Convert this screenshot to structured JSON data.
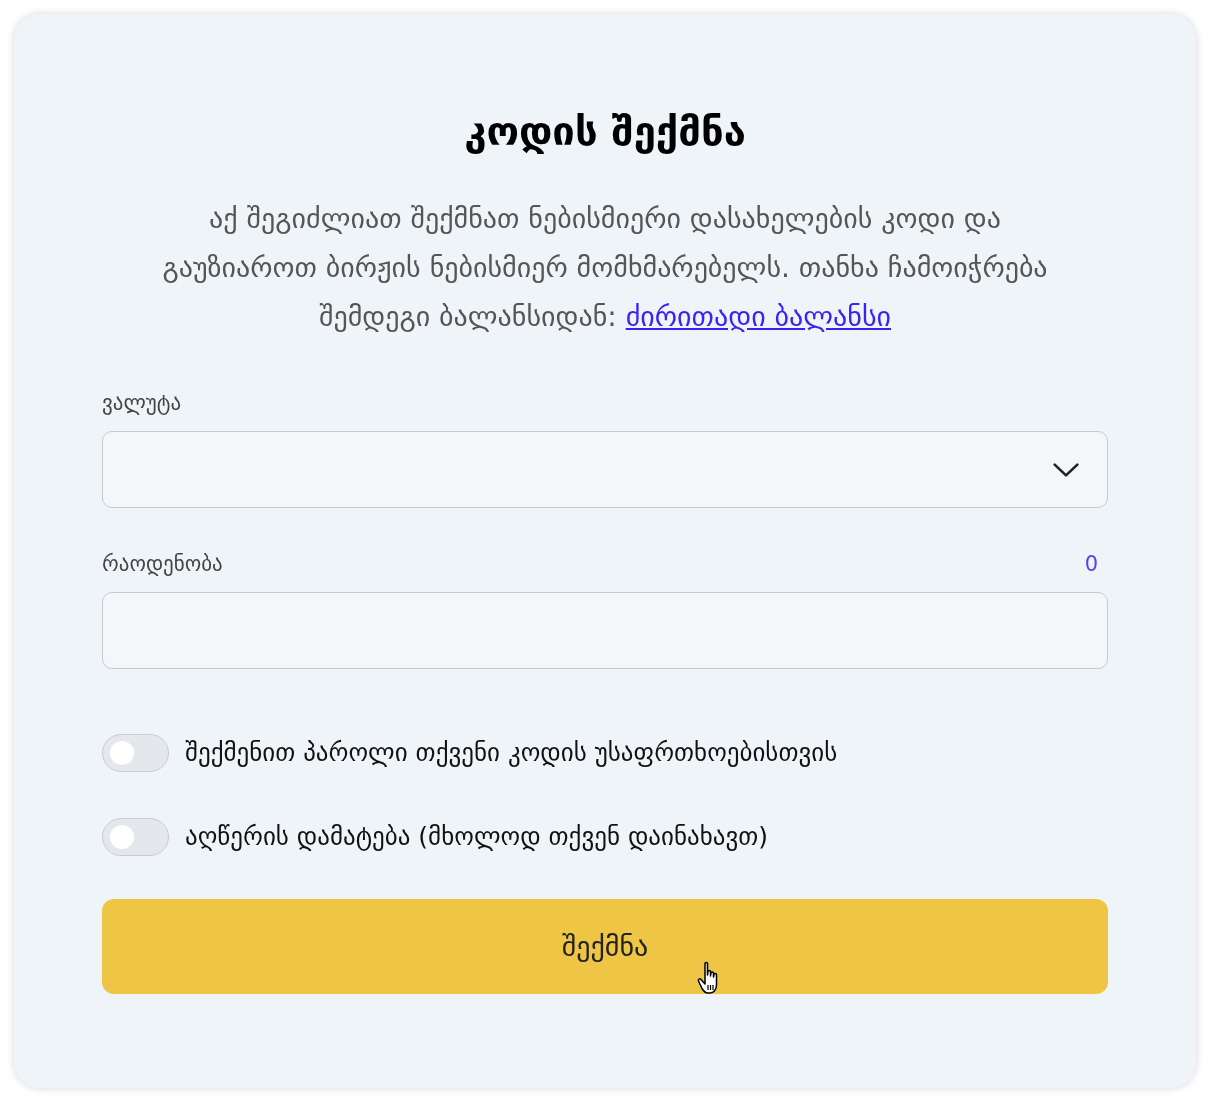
{
  "card": {
    "title": "კოდის შექმნა",
    "description": {
      "text": "აქ შეგიძლიათ შექმნათ ნებისმიერი დასახელების კოდი და გაუზიაროთ ბირჟის ნებისმიერ მომხმარებელს. თანხა ჩამოიჭრება შემდეგი ბალანსიდან:",
      "link": "ძირითადი ბალანსი"
    }
  },
  "form": {
    "fields": [
      {
        "kind": "select",
        "label": "ვალუტა"
      },
      {
        "kind": "input",
        "label": "რაოდენობა",
        "counter": "0"
      }
    ],
    "toggles": [
      {
        "label": "შექმენით პაროლი თქვენი კოდის უსაფრთხოებისთვის",
        "on": false
      },
      {
        "label": "აღწერის დამატება (მხოლოდ თქვენ დაინახავთ)",
        "on": false
      }
    ],
    "submit": {
      "label": "შექმნა"
    }
  }
}
